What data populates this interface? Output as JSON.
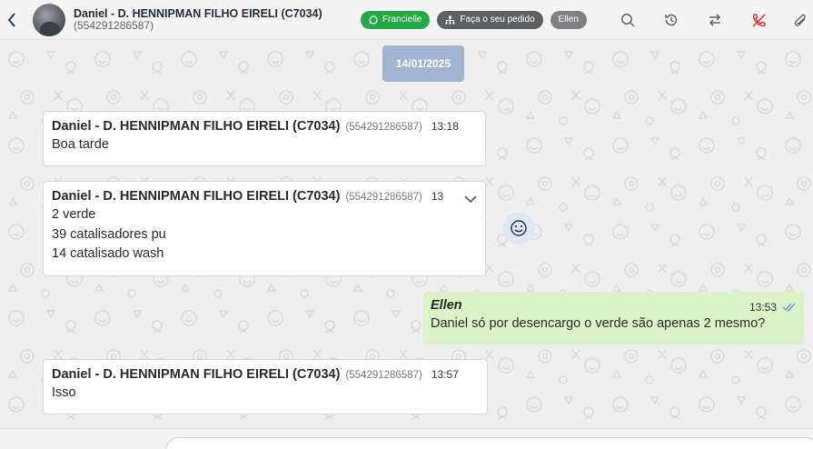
{
  "header": {
    "contact_name": "Daniel - D. HENNIPMAN FILHO EIRELI (C7034)",
    "contact_phone": "(554291286587)",
    "tags": {
      "agent": "Francielle",
      "order": "Faça o seu pedido",
      "user": "Ellen"
    },
    "icons": [
      "back-arrow-icon",
      "whatsapp-icon",
      "org-chart-icon",
      "search-icon",
      "history-icon",
      "transfer-icon",
      "end-call-icon",
      "attachment-icon"
    ]
  },
  "chat": {
    "date_chip": "14/01/2025",
    "messages": [
      {
        "sender": "Daniel - D. HENNIPMAN FILHO EIRELI (C7034)",
        "phone": "(554291286587)",
        "time": "13:18",
        "lines": [
          "Boa tarde"
        ]
      },
      {
        "sender": "Daniel - D. HENNIPMAN FILHO EIRELI (C7034)",
        "phone": "(554291286587)",
        "time": "13",
        "lines": [
          "2 verde",
          "39 catalisadores pu",
          "14 catalisado wash"
        ]
      },
      {
        "author": "Ellen",
        "time": "13:53",
        "text": "Daniel só por desencargo o verde são apenas 2 mesmo?",
        "status": "read"
      },
      {
        "sender": "Daniel - D. HENNIPMAN FILHO EIRELI (C7034)",
        "phone": "(554291286587)",
        "time": "13:57",
        "lines": [
          "Isso"
        ]
      }
    ]
  },
  "colors": {
    "agent_tag": "#25a845",
    "date_chip": "#a3b4d1",
    "outgoing_bubble": "#dcf3c8",
    "read_ticks": "#5aa0e0",
    "end_call": "#e0323b"
  }
}
